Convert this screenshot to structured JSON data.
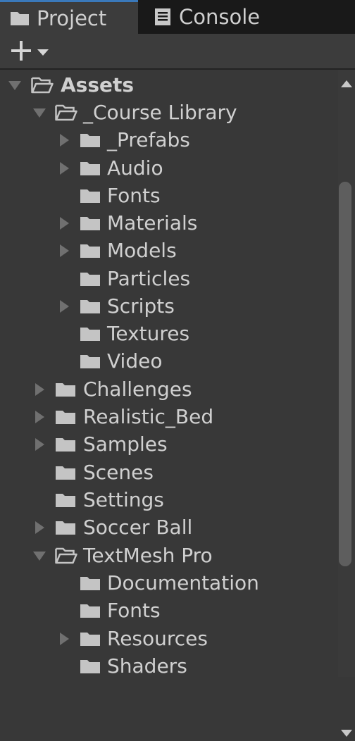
{
  "tabs": [
    {
      "label": "Project",
      "icon": "folder-icon",
      "active": true
    },
    {
      "label": "Console",
      "icon": "console-icon",
      "active": false
    }
  ],
  "toolbar": {
    "add_icon": "plus-icon",
    "dropdown_icon": "caret-down-icon"
  },
  "tree": {
    "items": [
      {
        "label": "Assets",
        "expanded": true,
        "has_children": true
      },
      {
        "label": "_Course Library",
        "expanded": true,
        "has_children": true
      },
      {
        "label": "_Prefabs",
        "expanded": false,
        "has_children": true
      },
      {
        "label": "Audio",
        "expanded": false,
        "has_children": true
      },
      {
        "label": "Fonts",
        "expanded": false,
        "has_children": false
      },
      {
        "label": "Materials",
        "expanded": false,
        "has_children": true
      },
      {
        "label": "Models",
        "expanded": false,
        "has_children": true
      },
      {
        "label": "Particles",
        "expanded": false,
        "has_children": false
      },
      {
        "label": "Scripts",
        "expanded": false,
        "has_children": true
      },
      {
        "label": "Textures",
        "expanded": false,
        "has_children": false
      },
      {
        "label": "Video",
        "expanded": false,
        "has_children": false
      },
      {
        "label": "Challenges",
        "expanded": false,
        "has_children": true
      },
      {
        "label": "Realistic_Bed",
        "expanded": false,
        "has_children": true
      },
      {
        "label": "Samples",
        "expanded": false,
        "has_children": true
      },
      {
        "label": "Scenes",
        "expanded": false,
        "has_children": false
      },
      {
        "label": "Settings",
        "expanded": false,
        "has_children": false
      },
      {
        "label": "Soccer Ball",
        "expanded": false,
        "has_children": true
      },
      {
        "label": "TextMesh Pro",
        "expanded": true,
        "has_children": true
      },
      {
        "label": "Documentation",
        "expanded": false,
        "has_children": false
      },
      {
        "label": "Fonts",
        "expanded": false,
        "has_children": false
      },
      {
        "label": "Resources",
        "expanded": false,
        "has_children": true
      },
      {
        "label": "Shaders",
        "expanded": false,
        "has_children": false
      }
    ]
  },
  "colors": {
    "background": "#383838",
    "tab_bar": "#191919",
    "active_tab_accent": "#3a79bb",
    "text": "#d0d0d0",
    "arrow": "#707070",
    "folder": "#c4c4c4"
  }
}
